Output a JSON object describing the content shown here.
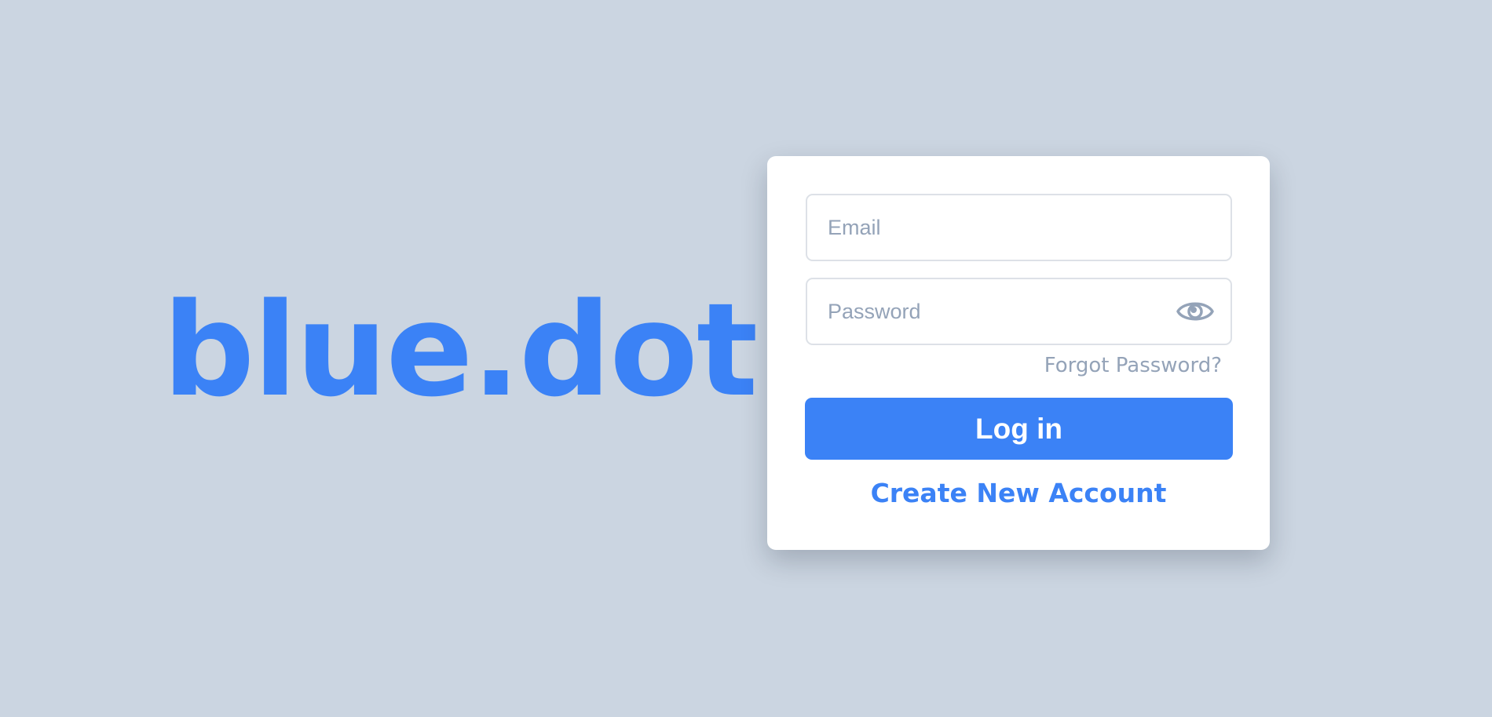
{
  "brand": {
    "logo_text": "blue.dot"
  },
  "login_form": {
    "email_placeholder": "Email",
    "email_value": "",
    "password_placeholder": "Password",
    "password_value": "",
    "password_toggle_icon": "eye-icon",
    "forgot_password_label": "Forgot Password?",
    "login_label": "Log in",
    "create_account_label": "Create New Account"
  },
  "colors": {
    "background": "#cbd5e1",
    "accent": "#3b82f6",
    "muted_text": "#94a3b8",
    "card": "#ffffff"
  }
}
